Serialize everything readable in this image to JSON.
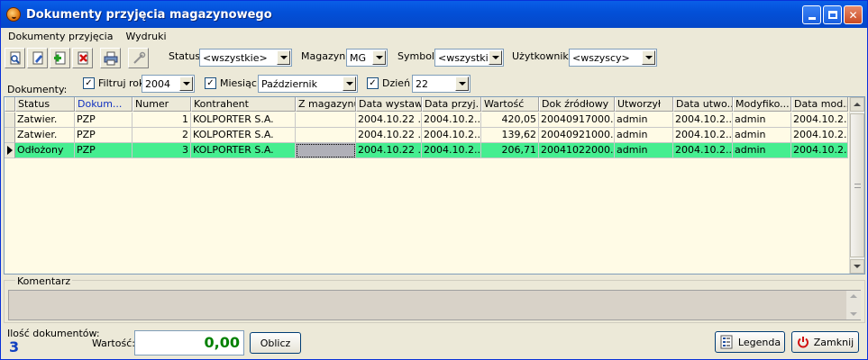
{
  "window": {
    "title": "Dokumenty przyjęcia magazynowego"
  },
  "menu": [
    "Dokumenty przyjęcia",
    "Wydruki"
  ],
  "filters": {
    "status_label": "Status:",
    "status_value": "<wszystkie>",
    "magazyn_label": "Magazyn:",
    "magazyn_value": "MG",
    "symbol_label": "Symbol:",
    "symbol_value": "<wszystkie>",
    "user_label": "Użytkownik:",
    "user_value": "<wszyscy>",
    "dokumenty_label": "Dokumenty:",
    "rok_label": "Filtruj rok",
    "rok_value": "2004",
    "miesiac_label": "Miesiąc",
    "miesiac_value": "Październik",
    "dzien_label": "Dzień",
    "dzien_value": "22"
  },
  "table": {
    "columns": [
      "Status",
      "Dokum...",
      "Numer",
      "Kontrahent",
      "Z magazynu",
      "Data wystaw.",
      "Data przyj.",
      "Wartość",
      "Dok źródłowy",
      "Utworzył",
      "Data utwo...",
      "Modyfiko...",
      "Data mod..."
    ],
    "rows": [
      [
        "Zatwier.",
        "PZP",
        "1",
        "KOLPORTER S.A.",
        "",
        "2004.10.22 ...",
        "2004.10.2...",
        "420,05",
        "20040917000...",
        "admin",
        "2004.10.2...",
        "admin",
        "2004.10.2..."
      ],
      [
        "Zatwier.",
        "PZP",
        "2",
        "KOLPORTER S.A.",
        "",
        "2004.10.22 ...",
        "2004.10.2...",
        "139,62",
        "20040921000...",
        "admin",
        "2004.10.2...",
        "admin",
        "2004.10.2..."
      ],
      [
        "Odłożony",
        "PZP",
        "3",
        "KOLPORTER S.A.",
        "",
        "2004.10.22 ...",
        "2004.10.2...",
        "206,71",
        "20041022000...",
        "admin",
        "2004.10.2...",
        "admin",
        "2004.10.2..."
      ]
    ],
    "selected_row": 2
  },
  "comment": {
    "label": "Komentarz",
    "text": ""
  },
  "footer": {
    "count_label": "Ilość dokumentów:",
    "count_value": "3",
    "value_label": "Wartość:",
    "value_value": "0,00",
    "calc_label": "Oblicz",
    "legend_label": "Legenda",
    "close_label": "Zamknij"
  },
  "colors": {
    "selected_row": "#45ee90",
    "grid_bg": "#fffbe6",
    "titlebar": "#0350d8"
  }
}
